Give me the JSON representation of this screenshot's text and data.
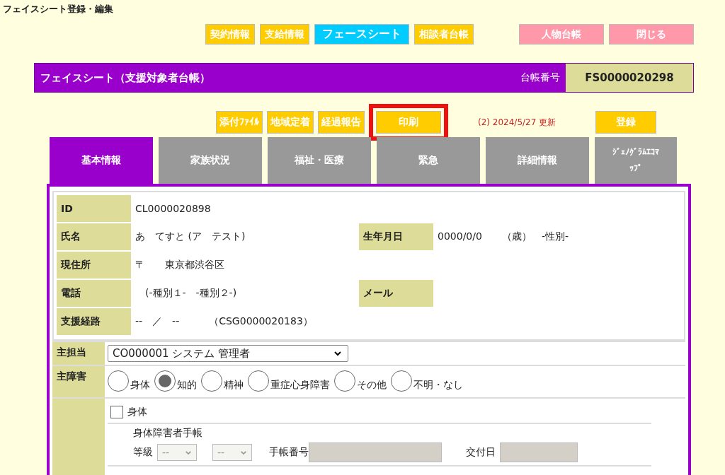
{
  "page_title": "フェイスシート登録・編集",
  "nav_buttons": [
    {
      "label": "契約情報",
      "kind": "main",
      "selected": false
    },
    {
      "label": "支給情報",
      "kind": "main",
      "selected": false
    },
    {
      "label": "フェースシート",
      "kind": "main",
      "selected": true
    },
    {
      "label": "相談者台帳",
      "kind": "main",
      "selected": false
    },
    {
      "label": "人物台帳",
      "kind": "aux",
      "selected": false
    },
    {
      "label": "閉じる",
      "kind": "aux",
      "selected": false
    }
  ],
  "header": {
    "title": "フェイスシート（支援対象者台帳）",
    "number_label": "台帳番号",
    "number": "FS0000020298"
  },
  "actions": [
    {
      "label": "添付ﾌｧｲﾙ",
      "highlighted": false
    },
    {
      "label": "地域定着",
      "highlighted": false
    },
    {
      "label": "経過報告",
      "highlighted": false
    },
    {
      "label": "印刷",
      "highlighted": true
    }
  ],
  "update_note": "(2)  2024/5/27 更新",
  "save_button": "登録",
  "tabs": [
    {
      "label": "基本情報",
      "selected": true
    },
    {
      "label": "家族状況",
      "selected": false
    },
    {
      "label": "福祉・医療",
      "selected": false
    },
    {
      "label": "緊急",
      "selected": false
    },
    {
      "label": "詳細情報",
      "selected": false
    },
    {
      "label": "ｼﾞｪﾉｸﾞﾗﾑｴｺﾏｯﾌﾟ",
      "selected": false
    }
  ],
  "info_rows": [
    {
      "label": "ID",
      "value": "CL0000020898"
    },
    {
      "label": "氏名",
      "value": "あ　てすと (ア　テスト)",
      "label_2": "生年月日",
      "value_2": "0000/0/0　　（歳）　-性別-"
    },
    {
      "label": "現住所",
      "value": "〒　　東京都渋谷区"
    },
    {
      "label": "電話",
      "value": "　(-種別１-　-種別２-)",
      "label_2": "メール"
    },
    {
      "label": "支援経路",
      "value": "--　／　--　　　（CSG0000020183）"
    }
  ],
  "staff": {
    "label": "主担当",
    "value": "CO000001 システム 管理者"
  },
  "disability": {
    "label": "主障害",
    "options": [
      {
        "label": "身体",
        "selected": false
      },
      {
        "label": "知的",
        "selected": true
      },
      {
        "label": "精神",
        "selected": false
      },
      {
        "label": "重症心身障害",
        "selected": false
      },
      {
        "label": "その他",
        "selected": false
      },
      {
        "label": "不明・なし",
        "selected": false
      }
    ]
  },
  "physical": {
    "label": "身体",
    "checked": false,
    "book_title": "身体障害者手帳",
    "grade_label": "等級",
    "grade_1": "--",
    "grade_2": "--",
    "number_label": "手帳番号",
    "date_label": "交付日"
  }
}
